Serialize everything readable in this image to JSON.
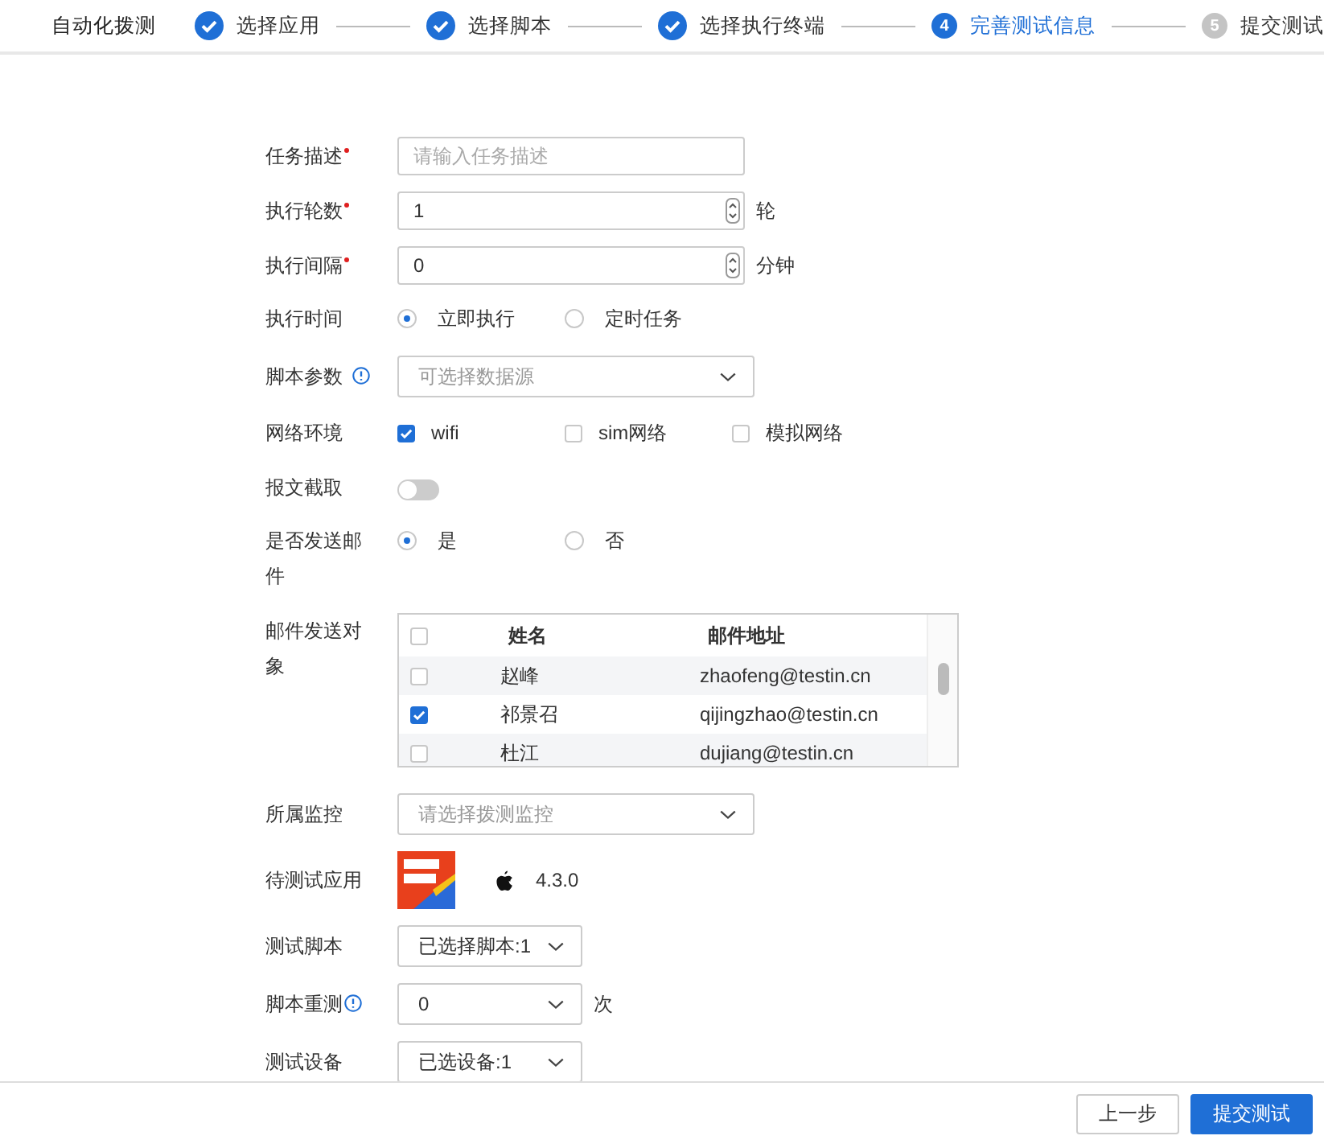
{
  "page_title": "自动化拨测",
  "steps": [
    {
      "label": "选择应用",
      "completed": true,
      "selected": false
    },
    {
      "label": "选择脚本",
      "completed": true,
      "selected": false
    },
    {
      "label": "选择执行终端",
      "completed": true,
      "selected": false
    },
    {
      "label": "完善测试信息",
      "completed": false,
      "selected": true,
      "number": "4"
    },
    {
      "label": "提交测试",
      "completed": false,
      "selected": false,
      "number": "5"
    }
  ],
  "form": [
    {
      "kind": "text",
      "label": "任务描述",
      "required": true,
      "placeholder": "请输入任务描述"
    },
    {
      "kind": "number",
      "label": "执行轮数",
      "required": true,
      "value": "1",
      "unit": "轮"
    },
    {
      "kind": "number",
      "label": "执行间隔",
      "required": true,
      "value": "0",
      "unit": "分钟"
    },
    {
      "kind": "radio",
      "label": "执行时间",
      "options": [
        {
          "label": "立即执行",
          "selected": true
        },
        {
          "label": "定时任务",
          "selected": false
        }
      ]
    },
    {
      "kind": "select",
      "label": "脚本参数",
      "info": true,
      "compact": false,
      "placeholder": "可选择数据源"
    },
    {
      "kind": "checkbox",
      "label": "网络环境",
      "options": [
        {
          "label": "wifi",
          "checked": true
        },
        {
          "label": "sim网络",
          "checked": false
        },
        {
          "label": "模拟网络",
          "checked": false
        }
      ]
    },
    {
      "kind": "toggle",
      "label": "报文截取",
      "on": false
    },
    {
      "kind": "radio",
      "label": "是否发送邮件",
      "options": [
        {
          "label": "是",
          "selected": true
        },
        {
          "label": "否",
          "selected": false
        }
      ]
    },
    {
      "kind": "table",
      "label": "邮件发送对象",
      "all_checked": false,
      "columns": [
        "姓名",
        "邮件地址"
      ],
      "rows": [
        {
          "name": "赵峰",
          "email": "zhaofeng@testin.cn",
          "checked": false
        },
        {
          "name": "祁景召",
          "email": "qijingzhao@testin.cn",
          "checked": true
        },
        {
          "name": "杜江",
          "email": "dujiang@testin.cn",
          "checked": false
        }
      ]
    },
    {
      "kind": "select",
      "label": "所属监控",
      "compact": false,
      "placeholder": "请选择拨测监控"
    },
    {
      "kind": "app",
      "label": "待测试应用",
      "version": "4.3.0"
    },
    {
      "kind": "select",
      "label": "测试脚本",
      "compact": true,
      "value": "已选择脚本:1"
    },
    {
      "kind": "select",
      "label": "脚本重测",
      "info": true,
      "compact": true,
      "value": "0",
      "unit": "次"
    },
    {
      "kind": "select",
      "label": "测试设备",
      "compact": true,
      "value": "已选设备:1"
    }
  ],
  "buttons": [
    {
      "label": "上一步",
      "primary": false
    },
    {
      "label": "提交测试",
      "primary": true
    }
  ]
}
